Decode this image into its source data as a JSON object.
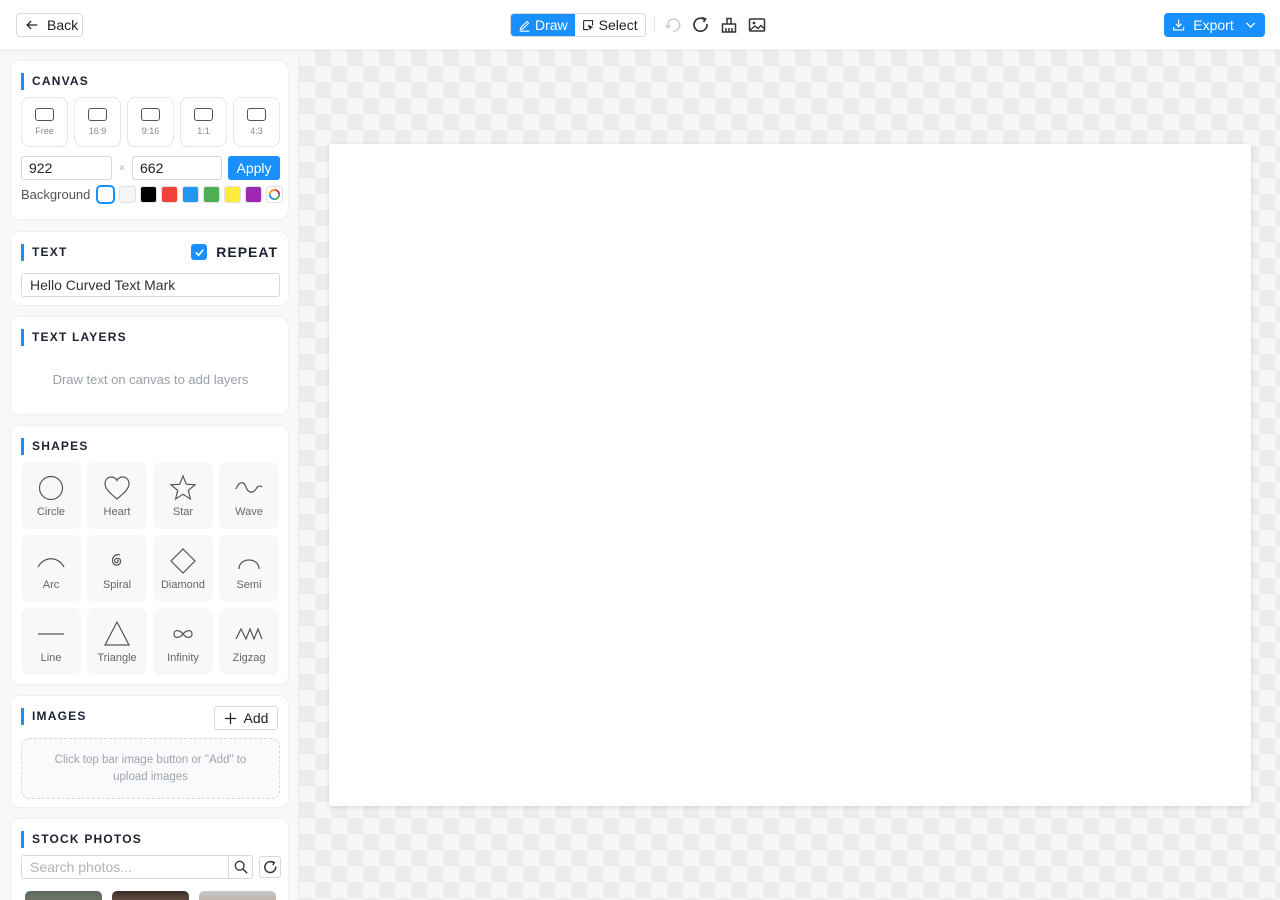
{
  "topbar": {
    "back_label": "Back",
    "modes": [
      {
        "label": "Draw",
        "active": true
      },
      {
        "label": "Select",
        "active": false
      }
    ],
    "export_label": "Export",
    "accent_color": "#1890ff"
  },
  "canvas": {
    "title": "CANVAS",
    "ratios": [
      "Free",
      "16:9",
      "9:16",
      "1:1",
      "4:3"
    ],
    "width": "922",
    "height": "662",
    "separator": "×",
    "apply_label": "Apply",
    "background_label": "Background",
    "swatches": [
      "#ffffff",
      "#f5f5f5",
      "#000000",
      "#f44336",
      "#2196f3",
      "#4caf50",
      "#ffeb3b",
      "#9c27b0"
    ]
  },
  "text": {
    "title": "TEXT",
    "repeat_label": "REPEAT",
    "repeat_checked": true,
    "value": "Hello Curved Text Mark"
  },
  "text_layers": {
    "title": "TEXT LAYERS",
    "empty_message": "Draw text on canvas to add layers"
  },
  "shapes": {
    "title": "SHAPES",
    "items": [
      {
        "label": "Circle",
        "icon": "circle-icon"
      },
      {
        "label": "Heart",
        "icon": "heart-icon"
      },
      {
        "label": "Star",
        "icon": "star-icon"
      },
      {
        "label": "Wave",
        "icon": "wave-icon"
      },
      {
        "label": "Arc",
        "icon": "arc-icon"
      },
      {
        "label": "Spiral",
        "icon": "spiral-icon"
      },
      {
        "label": "Diamond",
        "icon": "diamond-icon"
      },
      {
        "label": "Semi",
        "icon": "semi-icon"
      },
      {
        "label": "Line",
        "icon": "line-icon"
      },
      {
        "label": "Triangle",
        "icon": "triangle-icon"
      },
      {
        "label": "Infinity",
        "icon": "infinity-icon"
      },
      {
        "label": "Zigzag",
        "icon": "zigzag-icon"
      }
    ]
  },
  "images": {
    "title": "IMAGES",
    "add_label": "Add",
    "dropzone_text": "Click top bar image button or \"Add\" to upload images"
  },
  "stock_photos": {
    "title": "STOCK PHOTOS",
    "search_placeholder": "Search photos..."
  }
}
